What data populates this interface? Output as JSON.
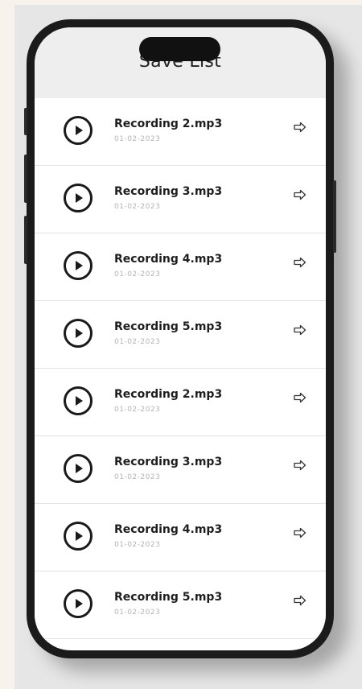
{
  "header": {
    "title": "Save List"
  },
  "recordings": [
    {
      "name": "Recording 2.mp3",
      "date": "01-02-2023"
    },
    {
      "name": "Recording 3.mp3",
      "date": "01-02-2023"
    },
    {
      "name": "Recording 4.mp3",
      "date": "01-02-2023"
    },
    {
      "name": "Recording 5.mp3",
      "date": "01-02-2023"
    },
    {
      "name": "Recording 2.mp3",
      "date": "01-02-2023"
    },
    {
      "name": "Recording 3.mp3",
      "date": "01-02-2023"
    },
    {
      "name": "Recording 4.mp3",
      "date": "01-02-2023"
    },
    {
      "name": "Recording 5.mp3",
      "date": "01-02-2023"
    }
  ],
  "icons": {
    "play": "play-icon",
    "open": "open-arrow-icon"
  },
  "colors": {
    "header_bg": "#eeeeee",
    "icon": "#1a1a1a",
    "date_text": "#b4b4b4"
  }
}
